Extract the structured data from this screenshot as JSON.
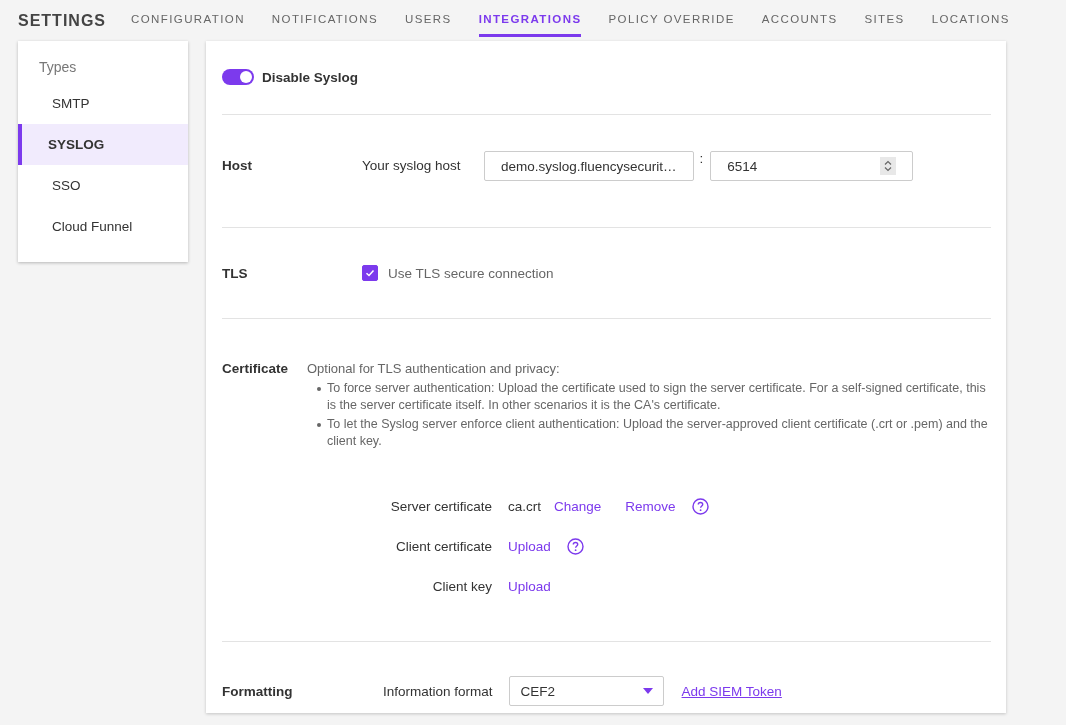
{
  "header": {
    "title": "SETTINGS"
  },
  "tabs": [
    {
      "label": "CONFIGURATION",
      "selected": false
    },
    {
      "label": "NOTIFICATIONS",
      "selected": false
    },
    {
      "label": "USERS",
      "selected": false
    },
    {
      "label": "INTEGRATIONS",
      "selected": true
    },
    {
      "label": "POLICY OVERRIDE",
      "selected": false
    },
    {
      "label": "ACCOUNTS",
      "selected": false
    },
    {
      "label": "SITES",
      "selected": false
    },
    {
      "label": "LOCATIONS",
      "selected": false
    }
  ],
  "sidebar": {
    "heading": "Types",
    "items": [
      {
        "label": "SMTP",
        "selected": false
      },
      {
        "label": "SYSLOG",
        "selected": true
      },
      {
        "label": "SSO",
        "selected": false
      },
      {
        "label": "Cloud Funnel",
        "selected": false
      }
    ]
  },
  "syslog_toggle": {
    "label": "Disable Syslog",
    "on": true
  },
  "host": {
    "label": "Host",
    "field_label": "Your syslog host",
    "host_value": "demo.syslog.fluencysecurit…",
    "separator": ":",
    "port_value": "6514"
  },
  "tls": {
    "label": "TLS",
    "option": "Use TLS secure connection",
    "checked": true
  },
  "certificate": {
    "label": "Certificate",
    "intro": "Optional for TLS authentication and privacy:",
    "bullets": [
      "To force server authentication: Upload the certificate used to sign the server certificate. For a self-signed certificate, this is the server certificate itself. In other scenarios it is the CA's certificate.",
      "To let the Syslog server enforce client authentication: Upload the server-approved client certificate (.crt or .pem) and the client key."
    ],
    "files": [
      {
        "label": "Server certificate",
        "file": "ca.crt",
        "actions": [
          "Change",
          "Remove"
        ],
        "help": true
      },
      {
        "label": "Client certificate",
        "actions": [
          "Upload"
        ],
        "help": true
      },
      {
        "label": "Client key",
        "actions": [
          "Upload"
        ],
        "help": false
      }
    ]
  },
  "formatting": {
    "label": "Formatting",
    "field_label": "Information format",
    "value": "CEF2",
    "link": "Add SIEM Token"
  }
}
